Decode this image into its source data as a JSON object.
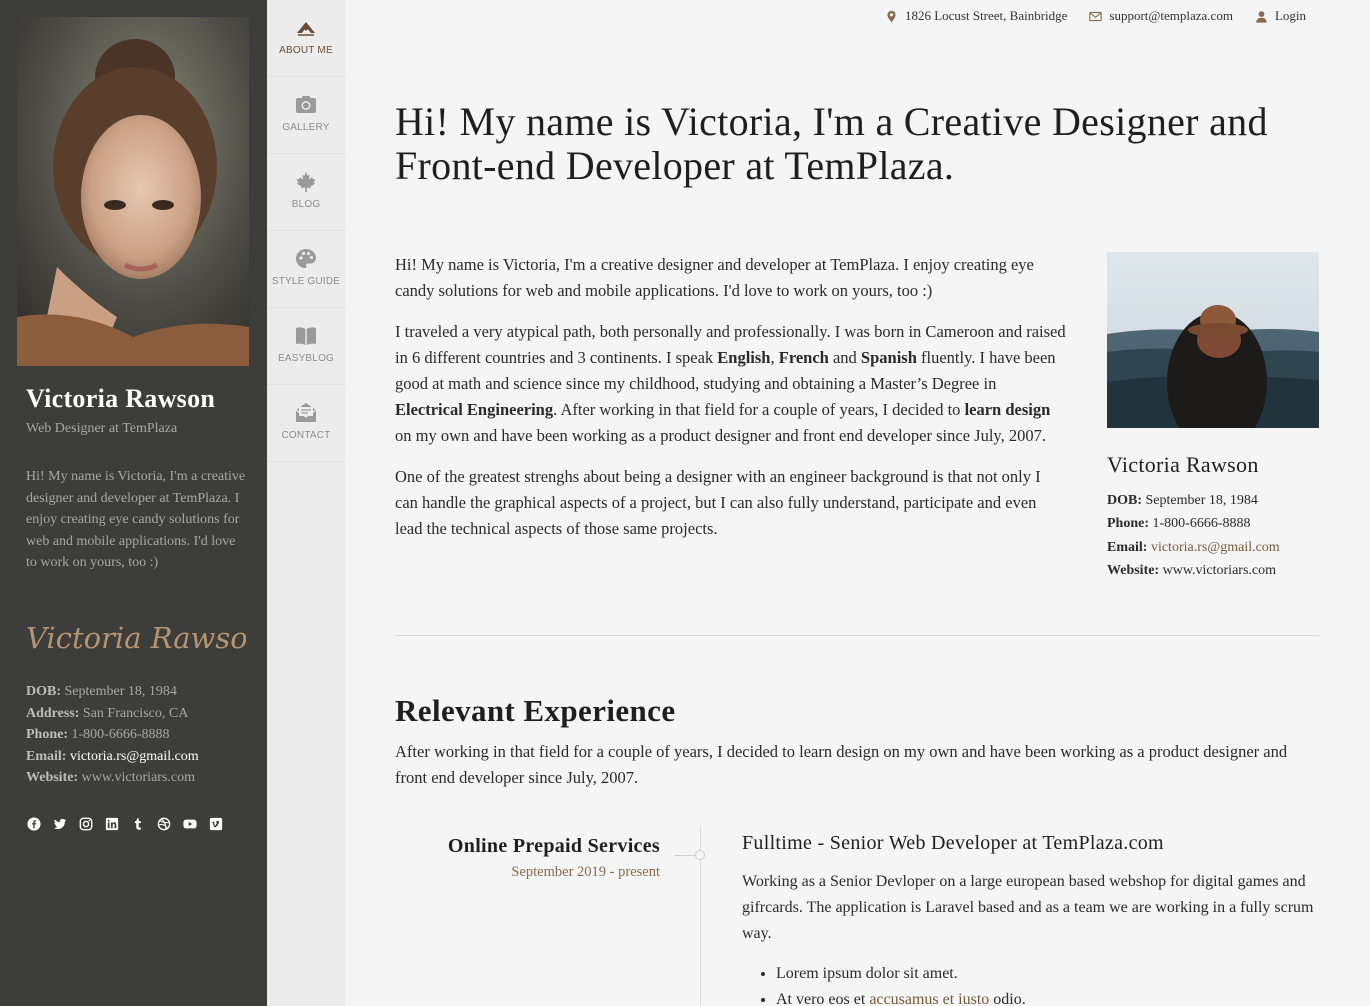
{
  "sidebar": {
    "name": "Victoria Rawson",
    "role": "Web Designer at TemPlaza",
    "bio": "Hi! My name is Victoria, I'm a creative designer and developer at TemPlaza. I enjoy creating eye candy solutions for web and mobile applications. I'd love to work on yours, too :)",
    "signature": "Victoria Rawson",
    "info": {
      "dob_label": "DOB:",
      "dob": "September 18, 1984",
      "address_label": "Address:",
      "address": "San Francisco, CA",
      "phone_label": "Phone:",
      "phone": "1-800-6666-8888",
      "email_label": "Email:",
      "email": "victoria.rs@gmail.com",
      "website_label": "Website:",
      "website": "www.victoriars.com"
    },
    "socials": [
      "facebook-icon",
      "twitter-icon",
      "instagram-icon",
      "linkedin-icon",
      "tumblr-icon",
      "dribbble-icon",
      "youtube-icon",
      "vimeo-icon"
    ]
  },
  "nav": {
    "items": [
      {
        "label": "ABOUT ME",
        "icon": "about-me-icon",
        "active": true
      },
      {
        "label": "GALLERY",
        "icon": "camera-icon"
      },
      {
        "label": "BLOG",
        "icon": "maple-leaf-icon"
      },
      {
        "label": "STYLE GUIDE",
        "icon": "palette-icon"
      },
      {
        "label": "EASYBLOG",
        "icon": "book-icon"
      },
      {
        "label": "CONTACT",
        "icon": "envelope-open-icon"
      }
    ]
  },
  "topbar": {
    "address": "1826 Locust Street, Bainbridge",
    "email": "support@templaza.com",
    "login": "Login"
  },
  "main": {
    "title": "Hi! My name is Victoria, I'm a Creative Designer and Front-end Developer at TemPlaza.",
    "p1": "Hi! My name is Victoria, I'm a creative designer and developer at TemPlaza. I enjoy creating eye candy solutions for web and mobile applications. I'd love to work on yours, too :)",
    "p2": {
      "a": "I traveled a very atypical path, both personally and professionally. I was born in Cameroon and raised in 6 different countries and 3 continents. I speak ",
      "english": "English",
      "comma": ", ",
      "french": "French",
      "and": " and ",
      "spanish": "Spanish",
      "b": " fluently. I have been good at math and science since my childhood, studying and obtaining a Master’s Degree in ",
      "ee": "Electrical Engineering",
      "c": ". After working in that field for a couple of years, I decided to ",
      "ld": "learn design",
      "d": " on my own and have been working as a product designer and front end developer since July, 2007."
    },
    "p3": "One of the greatest strenghs about being a designer with an engineer background is that not only I can handle the graphical aspects of a project, but I can also fully understand, participate and even lead the technical aspects of those same projects."
  },
  "card": {
    "name": "Victoria Rawson",
    "dob_label": "DOB:",
    "dob": "September 18, 1984",
    "phone_label": "Phone:",
    "phone": "1-800-6666-8888",
    "email_label": "Email:",
    "email": "victoria.rs@gmail.com",
    "website_label": "Website:",
    "website": "www.victoriars.com"
  },
  "experience": {
    "title": "Relevant Experience",
    "intro": "After working in that field for a couple of years, I decided to learn design on my own and have been working as a product designer and front end developer since July, 2007.",
    "job": {
      "company": "Online Prepaid Services",
      "date": "September 2019 - present",
      "title": "Fulltime - Senior Web Developer at TemPlaza.com",
      "desc": "Working as a Senior Devloper on a large european based webshop for digital games and gifrcards. The application is Laravel based and as a team we are working in a fully scrum way.",
      "bullet1": "Lorem ipsum dolor sit amet.",
      "bullet2_a": "At vero eos et ",
      "bullet2_link": "accusamus et iusto",
      "bullet2_b": " odio."
    }
  },
  "colors": {
    "sidebar_bg": "#3d3d3b",
    "accent": "#7a5a3a",
    "page_bg": "#f5f5f5"
  }
}
